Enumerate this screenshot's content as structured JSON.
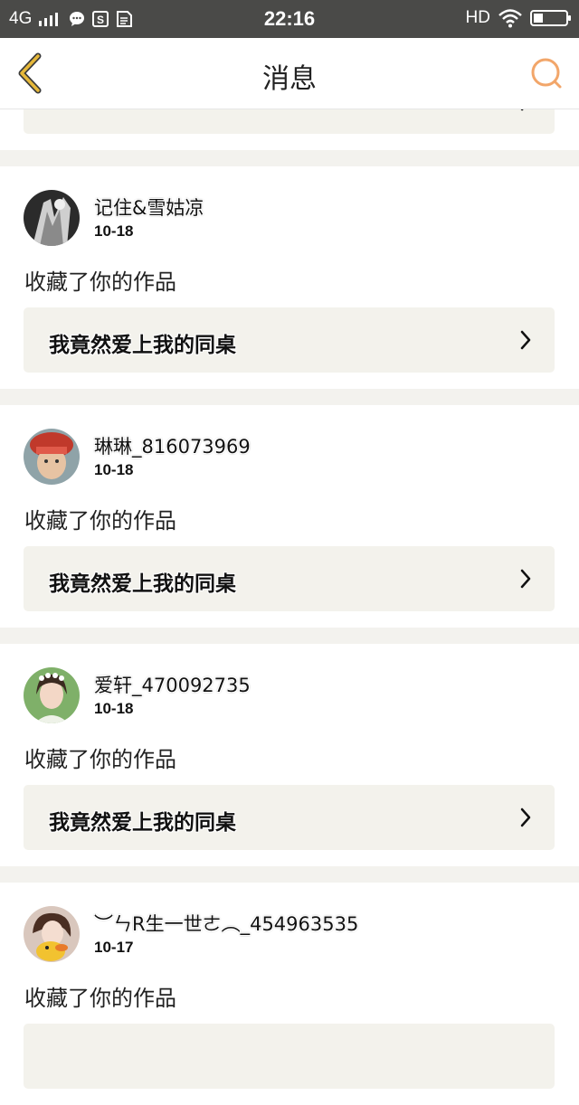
{
  "status_bar": {
    "network": "4G",
    "time": "22:16",
    "hd": "HD",
    "icons": [
      "signal-icon",
      "chat-bubble-icon",
      "sim-s-icon",
      "sim-card-icon",
      "wifi-icon",
      "battery-icon"
    ]
  },
  "nav": {
    "title": "消息",
    "back_icon": "chevron-left-icon",
    "search_icon": "search-icon",
    "accent": "#e0b040",
    "search_color": "#f2a66a"
  },
  "messages": [
    {
      "username": "记住&雪姑凉",
      "date": "10-18",
      "action": "收藏了你的作品",
      "work_title": "我竟然爱上我的同桌"
    },
    {
      "username": "琳琳_816073969",
      "date": "10-18",
      "action": "收藏了你的作品",
      "work_title": "我竟然爱上我的同桌"
    },
    {
      "username": "爱轩_470092735",
      "date": "10-18",
      "action": "收藏了你的作品",
      "work_title": "我竟然爱上我的同桌"
    },
    {
      "username": "︶ㄣR生一世ㄜ︵_454963535",
      "date": "10-17",
      "action": "收藏了你的作品",
      "work_title": ""
    }
  ]
}
